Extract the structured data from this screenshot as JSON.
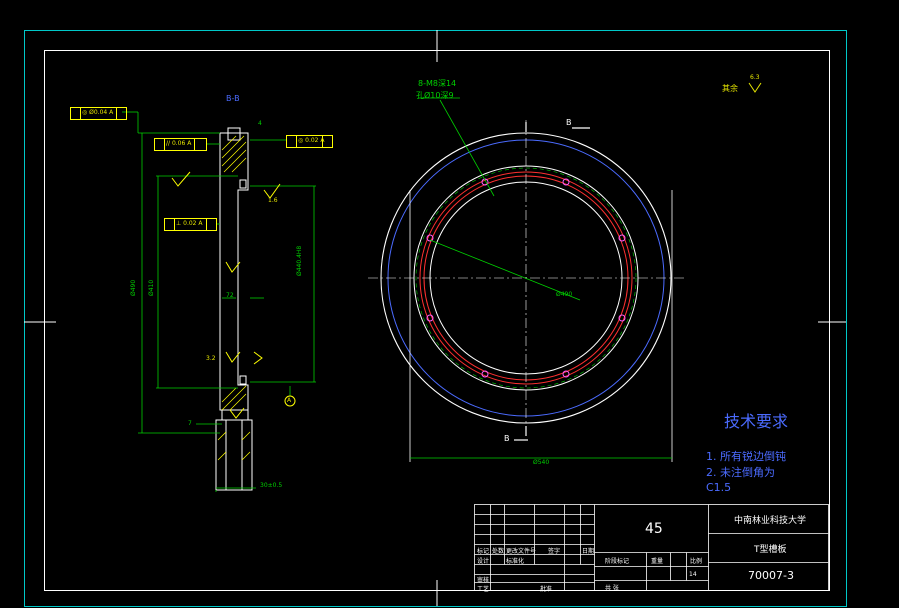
{
  "drawing": {
    "section_label": "B-B",
    "view_label_top": "B",
    "view_label_bottom": "B",
    "bolt_callout_line1": "8-M8深14",
    "bolt_callout_line2": "孔Ø10深9",
    "roughness_other": "其余",
    "roughness_value": "6.3",
    "roughness_local": "1.6",
    "roughness_side": "3.2",
    "dim_bore": "Ø440.4H8",
    "dim_outer": "Ø540",
    "dim_pitch": "Ø490",
    "dim_ring": "Ø410",
    "dim_width": "30±0.5",
    "dim_depth": "7",
    "dim_small": "4",
    "dim_height": "72",
    "tol_frame_1": "◎ Ø0.04 A",
    "tol_frame_2": "// 0.06 A",
    "tol_frame_3": "◎ 0.02 A",
    "tol_frame_4": "⊥ 0.02 A",
    "datum": "A"
  },
  "tech": {
    "heading": "技术要求",
    "line1": "1. 所有锐边倒钝",
    "line2": "2. 未注倒角为",
    "line3": "C1.5"
  },
  "title_block": {
    "school": "中南林业科技大学",
    "part_name": "T型槽板",
    "drawing_no": "70007-3",
    "material": "45",
    "scale_label": "比例",
    "weight_label": "重量",
    "stage_label": "阶段标记",
    "sheet_label": "共 张",
    "sheet_no": "14",
    "row_design": "设计",
    "row_check": "审核",
    "row_process": "工艺",
    "row_mark": "标记",
    "row_count": "处数",
    "row_zone": "更改文件号",
    "row_sign": "签字",
    "row_date": "日期",
    "row_std": "标准化",
    "row_approve": "批准"
  },
  "colors": {
    "frame": "#ffffff",
    "border": "#00c8c8",
    "part": "#ffffff",
    "dim": "#00d000",
    "hidden": "#ffff00",
    "hatch": "#ffff00",
    "blue": "#4b6bff",
    "red": "#ff3030"
  }
}
